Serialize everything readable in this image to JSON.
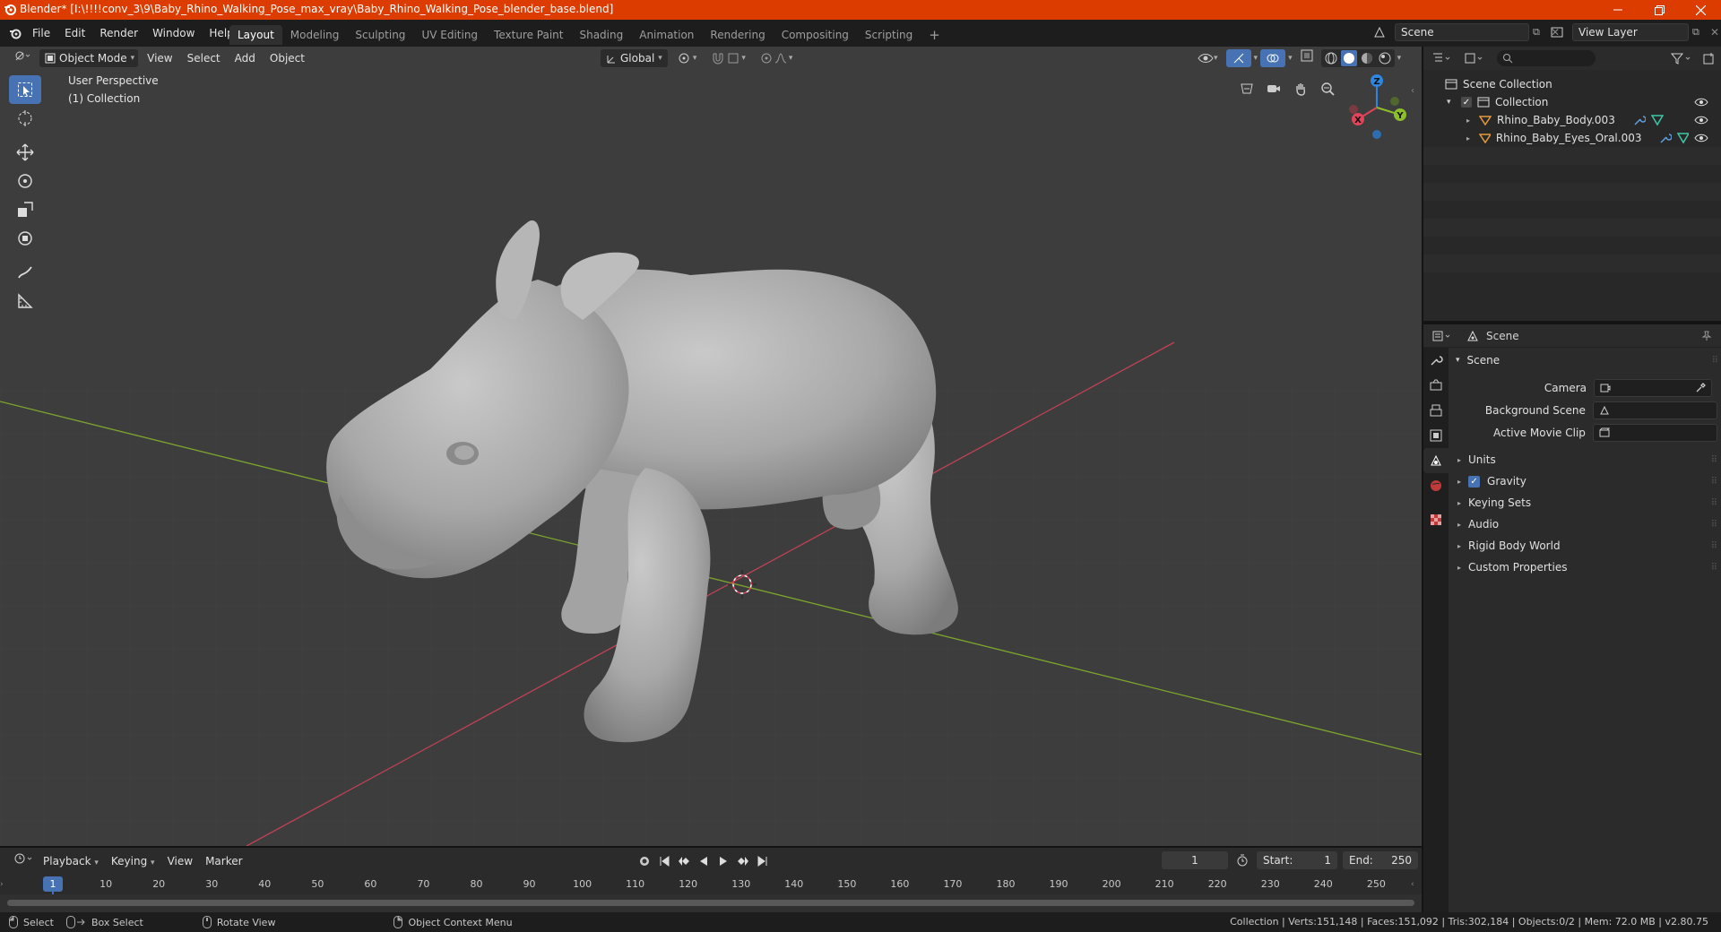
{
  "window": {
    "title": "Blender* [I:\\!!!!conv_3\\9\\Baby_Rhino_Walking_Pose_max_vray\\Baby_Rhino_Walking_Pose_blender_base.blend]"
  },
  "menu": [
    "File",
    "Edit",
    "Render",
    "Window",
    "Help"
  ],
  "workspaces": [
    "Layout",
    "Modeling",
    "Sculpting",
    "UV Editing",
    "Texture Paint",
    "Shading",
    "Animation",
    "Rendering",
    "Compositing",
    "Scripting"
  ],
  "active_workspace": "Layout",
  "scene_field": "Scene",
  "view_layer_field": "View Layer",
  "viewport": {
    "mode": "Object Mode",
    "menus": [
      "View",
      "Select",
      "Add",
      "Object"
    ],
    "transform_orientation": "Global",
    "overlay_line1": "User Perspective",
    "overlay_line2": "(1) Collection",
    "gizmo": {
      "x": "X",
      "y": "Y",
      "z": "Z"
    }
  },
  "outliner": {
    "root": "Scene Collection",
    "collection": "Collection",
    "objects": [
      "Rhino_Baby_Body.003",
      "Rhino_Baby_Eyes_Oral.003"
    ]
  },
  "properties": {
    "context": "Scene",
    "panel": "Scene",
    "fields": [
      {
        "label": "Camera",
        "value": ""
      },
      {
        "label": "Background Scene",
        "value": ""
      },
      {
        "label": "Active Movie Clip",
        "value": ""
      }
    ],
    "sections": [
      {
        "label": "Units",
        "checkbox": false
      },
      {
        "label": "Gravity",
        "checkbox": true
      },
      {
        "label": "Keying Sets",
        "checkbox": false
      },
      {
        "label": "Audio",
        "checkbox": false
      },
      {
        "label": "Rigid Body World",
        "checkbox": false
      },
      {
        "label": "Custom Properties",
        "checkbox": false
      }
    ]
  },
  "timeline": {
    "menus": [
      "Playback",
      "Keying",
      "View",
      "Marker"
    ],
    "current_frame": "1",
    "start_label": "Start:",
    "start": "1",
    "end_label": "End:",
    "end": "250",
    "ruler": [
      "1",
      "10",
      "20",
      "30",
      "40",
      "50",
      "60",
      "70",
      "80",
      "90",
      "100",
      "110",
      "120",
      "130",
      "140",
      "150",
      "160",
      "170",
      "180",
      "190",
      "200",
      "210",
      "220",
      "230",
      "240",
      "250"
    ]
  },
  "status": {
    "select": "Select",
    "box_select": "Box Select",
    "rotate_view": "Rotate View",
    "context_menu": "Object Context Menu",
    "stats": "Collection | Verts:151,148 | Faces:151,092 | Tris:302,184 | Objects:0/2 | Mem: 72.0 MB | v2.80.75"
  },
  "colors": {
    "titlebar": "#dd3c00",
    "accent": "#4772b3",
    "x_axis": "#e0445a",
    "y_axis": "#8cbf2a",
    "z_axis": "#2f86e0"
  }
}
